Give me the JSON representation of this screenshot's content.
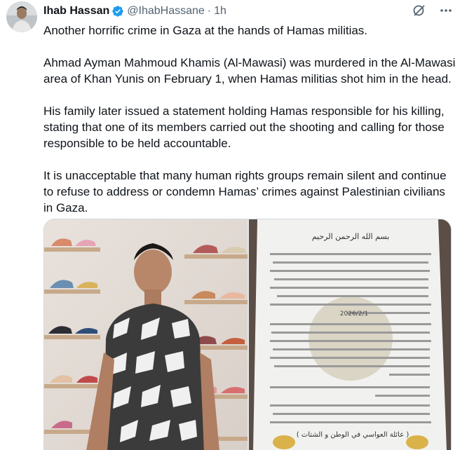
{
  "author": {
    "name": "Ihab Hassan",
    "handle": "@IhabHassane",
    "separator": "·",
    "time": "1h",
    "verified": true,
    "verified_color": "#1d9bf0"
  },
  "icons": {
    "verified": "verified-badge-icon",
    "grok": "grok-icon",
    "more": "more-options-icon"
  },
  "tweet": {
    "paragraphs": [
      "Another horrific crime in Gaza at the hands of Hamas militias.",
      "Ahmad Ayman Mahmoud Khamis (Al-Mawasi) was murdered in the Al-Mawasi area of Khan Yunis on February 1, when Hamas militias shot him in the head.",
      "His family later issued a statement holding Hamas responsible for his killing, stating that one of its members carried out the shooting and calling for those responsible to be held accountable.",
      "It is unacceptable that many human rights groups remain silent and continue to refuse to address or condemn Hamas’ crimes against Palestinian civilians in Gaza."
    ]
  },
  "document": {
    "basmala": "بسم الله الرحمن الرحيم",
    "date": "2026/2/1",
    "signature": "( عائلة العواسي في الوطن و الشتات )"
  }
}
